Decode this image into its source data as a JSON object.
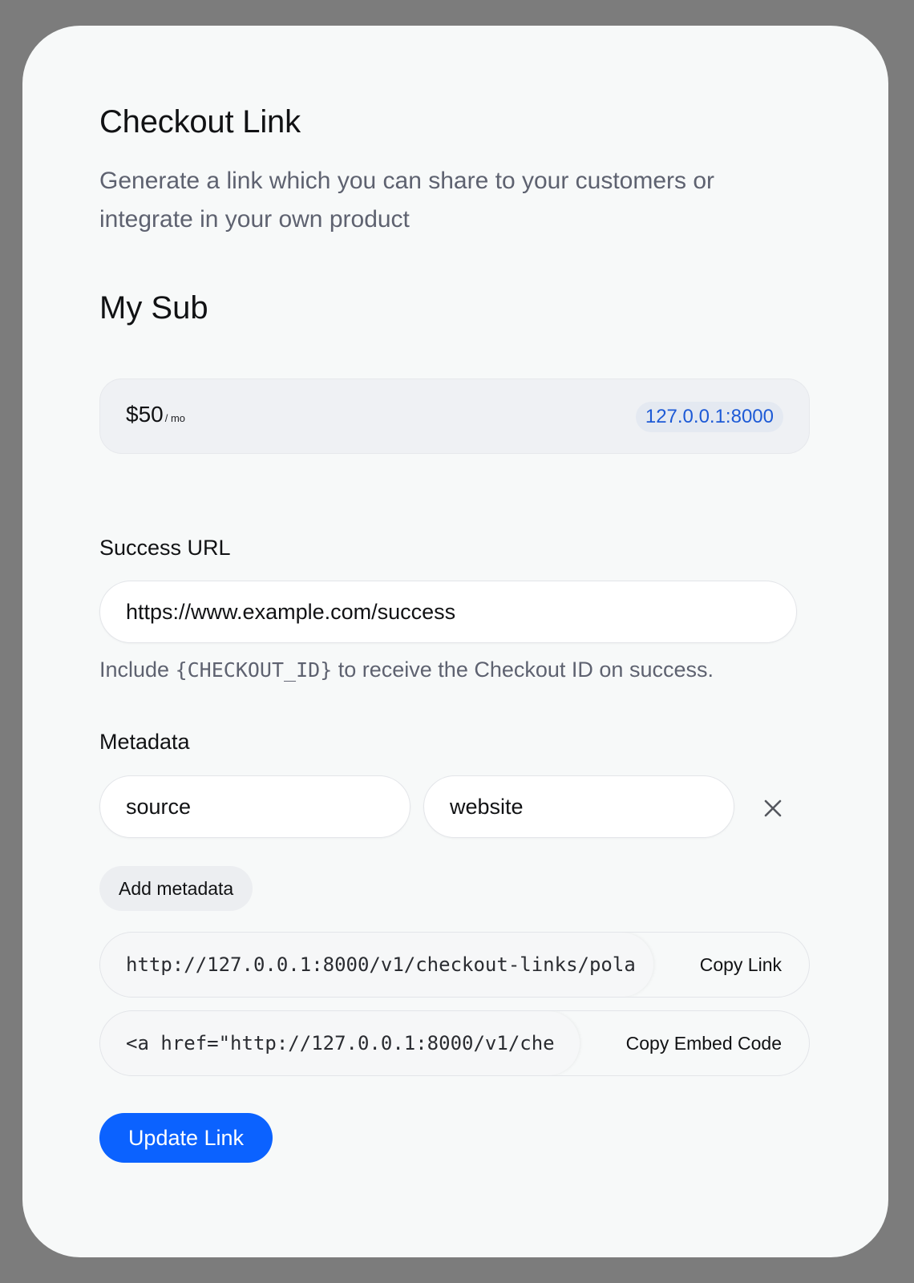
{
  "modal": {
    "title": "Checkout Link",
    "subtitle": "Generate a link which you can share to your customers or integrate in your own product"
  },
  "product": {
    "name": "My Sub",
    "price": "$50",
    "price_unit": "/ mo",
    "host_badge": "127.0.0.1:8000"
  },
  "success_url": {
    "label": "Success URL",
    "value": "https://www.example.com/success",
    "helper_prefix": "Include ",
    "helper_code": "{CHECKOUT_ID}",
    "helper_suffix": " to receive the Checkout ID on success."
  },
  "metadata": {
    "label": "Metadata",
    "entries": [
      {
        "key": "source",
        "value": "website"
      }
    ],
    "remove_icon": "close-icon",
    "add_label": "Add metadata"
  },
  "link": {
    "value": "http://127.0.0.1:8000/v1/checkout-links/pola",
    "copy_label": "Copy Link"
  },
  "embed": {
    "value": "<a href=\"http://127.0.0.1:8000/v1/che",
    "copy_label": "Copy Embed Code"
  },
  "actions": {
    "update_label": "Update Link"
  },
  "colors": {
    "primary": "#0b62ff",
    "badge_text": "#1d5ad6"
  }
}
